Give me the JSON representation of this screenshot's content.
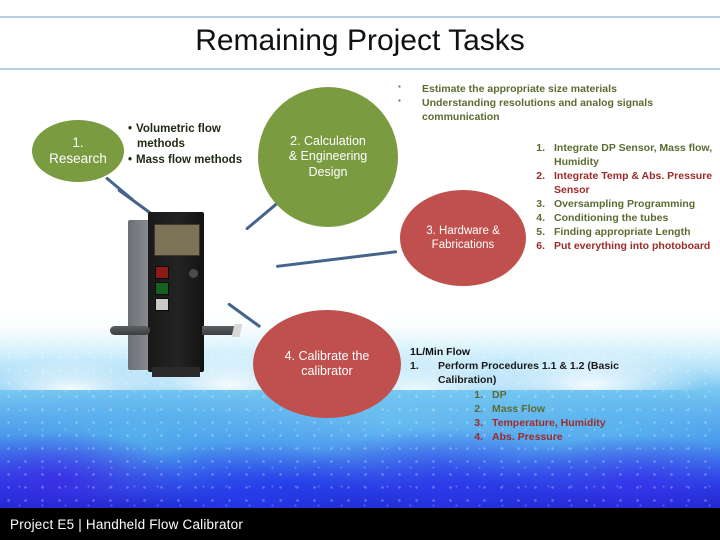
{
  "slide": {
    "title": "Remaining Project Tasks",
    "footer": "Project E5 | Handheld Flow Calibrator"
  },
  "colors": {
    "green": "#7b9b40",
    "red": "#c0504d",
    "green_text": "#5b6b31",
    "red_text": "#9e2a28",
    "connector": "#44648c",
    "rule": "#b9cfdd",
    "footer_bg": "#000000"
  },
  "nodes": {
    "research": "1.\nResearch",
    "research_line1": "1.",
    "research_line2": "Research",
    "calculation_line1": "2. Calculation",
    "calculation_line2": "& Engineering",
    "calculation_line3": "Design",
    "hardware_line1": "3. Hardware &",
    "hardware_line2": "Fabrications",
    "calibrate_line1": "4. Calibrate the",
    "calibrate_line2": "calibrator"
  },
  "research_bullets": [
    "Volumetric flow methods",
    "Mass flow methods"
  ],
  "calculation_bullets": [
    "Estimate the appropriate size materials",
    "Understanding resolutions and analog signals communication"
  ],
  "hardware_items": [
    {
      "num": "1.",
      "text": "Integrate DP Sensor, Mass flow, Humidity",
      "color": "green"
    },
    {
      "num": "2.",
      "text": "Integrate Temp & Abs. Pressure Sensor",
      "color": "red"
    },
    {
      "num": "3.",
      "text": "Oversampling Programming",
      "color": "green"
    },
    {
      "num": "4.",
      "text": "Conditioning the tubes",
      "color": "green"
    },
    {
      "num": "5.",
      "text": "Finding appropriate Length",
      "color": "green"
    },
    {
      "num": "6.",
      "text": "Put everything into photoboard",
      "color": "red"
    }
  ],
  "flow_block": {
    "heading": "1L/Min Flow",
    "item_num": "1.",
    "item_text": "Perform Procedures 1.1 & 1.2 (Basic Calibration)",
    "sub_items": [
      {
        "num": "1.",
        "text": "DP",
        "color": "green"
      },
      {
        "num": "2.",
        "text": "Mass Flow",
        "color": "green"
      },
      {
        "num": "3.",
        "text": "Temperature, Humidity",
        "color": "red"
      },
      {
        "num": "4.",
        "text": "Abs. Pressure",
        "color": "red"
      }
    ]
  },
  "device": {
    "label": "handheld-flow-calibrator-illustration"
  }
}
